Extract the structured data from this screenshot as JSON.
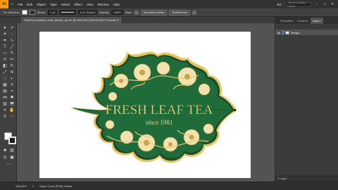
{
  "app": {
    "logo": "Ai",
    "menu": [
      "File",
      "Edit",
      "Object",
      "Type",
      "Select",
      "Effect",
      "View",
      "Window",
      "Help"
    ],
    "workspace": "BG",
    "search_placeholder": "Search Adobe Stock"
  },
  "control_bar": {
    "selection_label": "No Selection",
    "stroke_label": "Stroke:",
    "stroke_value": "1 pt",
    "brush_label": "5 pt. Round",
    "opacity_label": "Opacity:",
    "opacity_value": "100%",
    "style_label": "Style:",
    "document_setup": "Document Setup",
    "preferences": "Preferences"
  },
  "document": {
    "tab_title": "PrintCut-workflow_Leaf_Sticker_dp.ai* @ 105.64% (CMYK/GPU Preview)"
  },
  "artwork": {
    "title": "FRESH LEAF TEA",
    "subtitle": "since 1981"
  },
  "panel": {
    "tabs": [
      "Properties",
      "Libraries",
      "Layers"
    ],
    "active_tab": "Layers",
    "layer_name": "Design",
    "footer": "1 Layer"
  },
  "status": {
    "zoom": "105.64%",
    "page": "1",
    "tool_hint": "Selection",
    "info": "Same Color (RGB) Global"
  },
  "colors": {
    "leaf_green": "#1f6b3a",
    "leaf_border": "#e8c25a",
    "gold": "#e7c76b"
  }
}
